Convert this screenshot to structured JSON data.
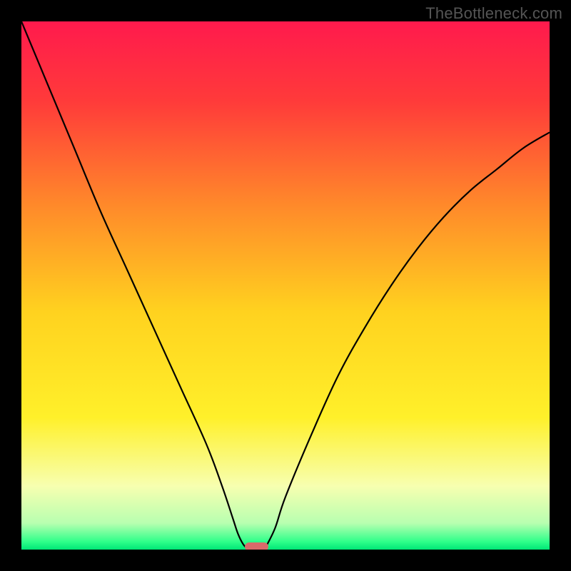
{
  "watermark": "TheBottleneck.com",
  "chart_data": {
    "type": "line",
    "title": "",
    "xlabel": "",
    "ylabel": "",
    "xlim": [
      0,
      100
    ],
    "ylim": [
      0,
      100
    ],
    "grid": false,
    "legend": false,
    "annotations": [],
    "series": [
      {
        "name": "left-curve",
        "x": [
          0,
          5,
          10,
          15,
          20,
          25,
          30,
          35,
          38,
          40,
          41,
          42,
          43
        ],
        "y": [
          100,
          88,
          76,
          64,
          53,
          42,
          31,
          20,
          12,
          6,
          3,
          1,
          0
        ]
      },
      {
        "name": "right-curve",
        "x": [
          46,
          48,
          50,
          55,
          60,
          65,
          70,
          75,
          80,
          85,
          90,
          95,
          100
        ],
        "y": [
          0,
          4,
          10,
          22,
          33,
          42,
          50,
          57,
          63,
          68,
          72,
          76,
          79
        ]
      }
    ],
    "gradient_stops": [
      {
        "offset": 0.0,
        "color": "#ff1a4d"
      },
      {
        "offset": 0.15,
        "color": "#ff3a3a"
      },
      {
        "offset": 0.35,
        "color": "#ff8a2a"
      },
      {
        "offset": 0.55,
        "color": "#ffd21f"
      },
      {
        "offset": 0.75,
        "color": "#fff02a"
      },
      {
        "offset": 0.88,
        "color": "#f7ffb0"
      },
      {
        "offset": 0.95,
        "color": "#b8ffb0"
      },
      {
        "offset": 0.985,
        "color": "#2fff8a"
      },
      {
        "offset": 1.0,
        "color": "#00e676"
      }
    ],
    "marker": {
      "x": 44.5,
      "y": 0.5,
      "width_pct": 4.5,
      "height_pct": 1.6,
      "color": "#d96a6a"
    }
  }
}
